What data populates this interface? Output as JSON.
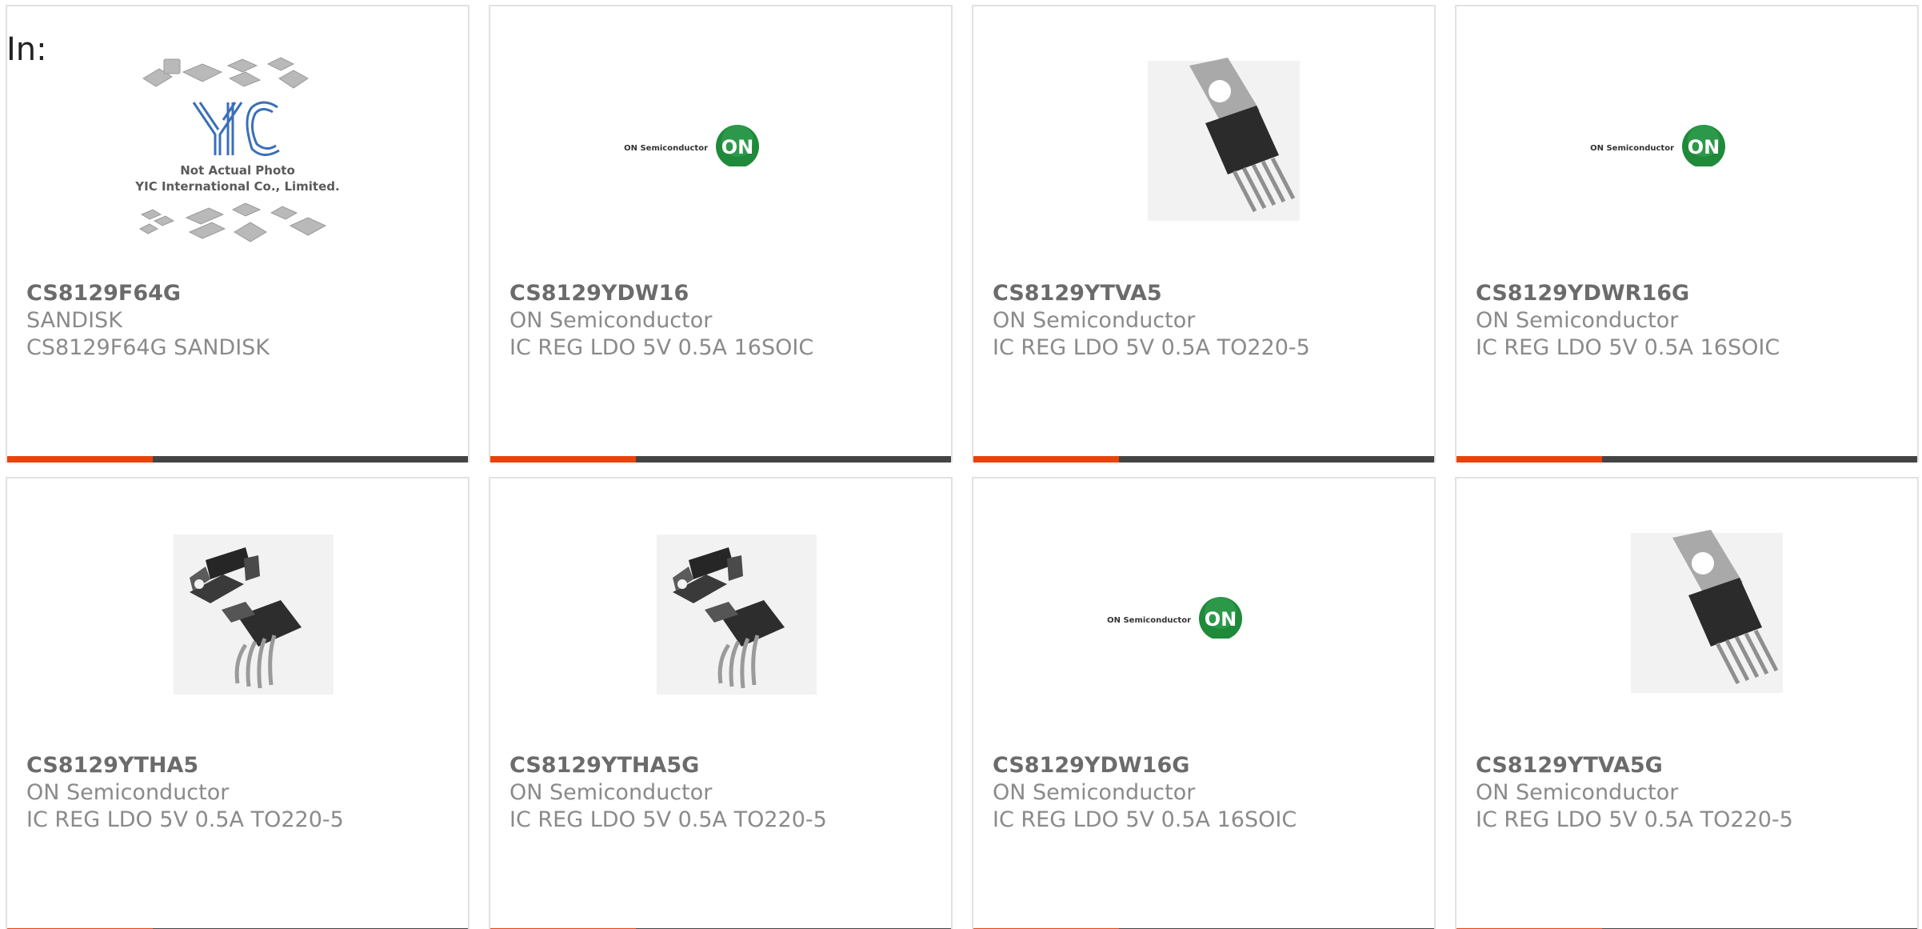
{
  "header": {
    "label": "In:"
  },
  "colors": {
    "accent": "#e8430b",
    "bar": "#444444",
    "on_green": "#1e8a3a"
  },
  "placeholder_image": {
    "line1": "Not Actual Photo",
    "line2": "YIC International Co., Limited.",
    "logo": "YIC"
  },
  "on_logo": {
    "wordmark": "ON Semiconductor",
    "badge": "ON"
  },
  "products": [
    {
      "part": "CS8129F64G",
      "manufacturer": "SANDISK",
      "description": "CS8129F64G SANDISK",
      "image": "placeholder"
    },
    {
      "part": "CS8129YDW16",
      "manufacturer": "ON Semiconductor",
      "description": "IC REG LDO 5V 0.5A 16SOIC",
      "image": "on-logo"
    },
    {
      "part": "CS8129YTVA5",
      "manufacturer": "ON Semiconductor",
      "description": "IC REG LDO 5V 0.5A TO220-5",
      "image": "to220-vertical"
    },
    {
      "part": "CS8129YDWR16G",
      "manufacturer": "ON Semiconductor",
      "description": "IC REG LDO 5V 0.5A 16SOIC",
      "image": "on-logo"
    },
    {
      "part": "CS8129YTHA5",
      "manufacturer": "ON Semiconductor",
      "description": "IC REG LDO 5V 0.5A TO220-5",
      "image": "to220-bent"
    },
    {
      "part": "CS8129YTHA5G",
      "manufacturer": "ON Semiconductor",
      "description": "IC REG LDO 5V 0.5A TO220-5",
      "image": "to220-bent"
    },
    {
      "part": "CS8129YDW16G",
      "manufacturer": "ON Semiconductor",
      "description": "IC REG LDO 5V 0.5A 16SOIC",
      "image": "on-logo"
    },
    {
      "part": "CS8129YTVA5G",
      "manufacturer": "ON Semiconductor",
      "description": "IC REG LDO 5V 0.5A TO220-5",
      "image": "to220-vertical"
    }
  ]
}
